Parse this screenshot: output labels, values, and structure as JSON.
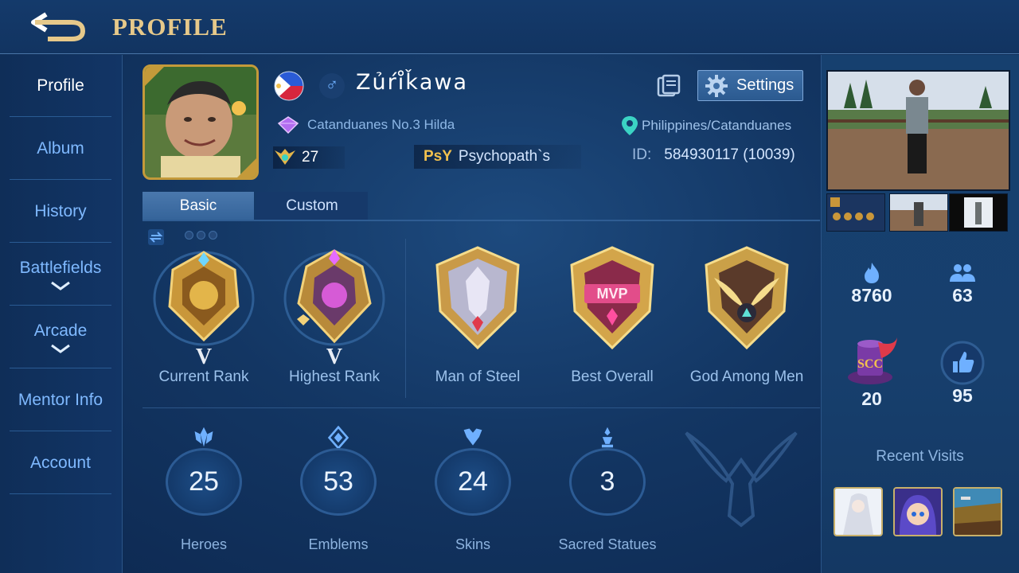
{
  "header": {
    "title": "PROFILE"
  },
  "sidebar": {
    "items": [
      {
        "label": "Profile",
        "active": true
      },
      {
        "label": "Album"
      },
      {
        "label": "History"
      },
      {
        "label": "Battlefields",
        "expandable": true
      },
      {
        "label": "Arcade",
        "expandable": true
      },
      {
        "label": "Mentor Info"
      },
      {
        "label": "Account"
      }
    ]
  },
  "profile": {
    "name": "Zủŕi̊ǩawa",
    "gender_symbol": "♂",
    "rank_title": "Catanduanes No.3 Hilda",
    "level": "27",
    "squad_tag": "PsY",
    "squad_name": "Psychopath`s",
    "location": "Philippines/Catanduanes",
    "id_label": "ID:",
    "id_value": "584930117 (10039)",
    "settings_label": "Settings"
  },
  "tabs": [
    {
      "label": "Basic",
      "active": true
    },
    {
      "label": "Custom"
    }
  ],
  "badges": [
    {
      "label": "Current Rank",
      "roman": "V",
      "icon": "lion-rank-icon"
    },
    {
      "label": "Highest Rank",
      "roman": "V",
      "icon": "dragon-rank-icon"
    },
    {
      "label": "Man of Steel",
      "icon": "knight-shield-icon"
    },
    {
      "label": "Best Overall",
      "icon": "mvp-shield-icon"
    },
    {
      "label": "God Among Men",
      "icon": "winged-shield-icon"
    }
  ],
  "stats": [
    {
      "label": "Heroes",
      "value": "25",
      "icon": "hero-icon"
    },
    {
      "label": "Emblems",
      "value": "53",
      "icon": "emblem-icon"
    },
    {
      "label": "Skins",
      "value": "24",
      "icon": "skin-icon"
    },
    {
      "label": "Sacred Statues",
      "value": "3",
      "icon": "statue-icon"
    }
  ],
  "right_panel": {
    "popularity": "8760",
    "followers": "63",
    "charm": "20",
    "likes": "95",
    "recent_visits_label": "Recent Visits"
  },
  "colors": {
    "accent_gold": "#e6c98a",
    "text_blue": "#7fb9ff",
    "panel_bg": "#133663"
  }
}
